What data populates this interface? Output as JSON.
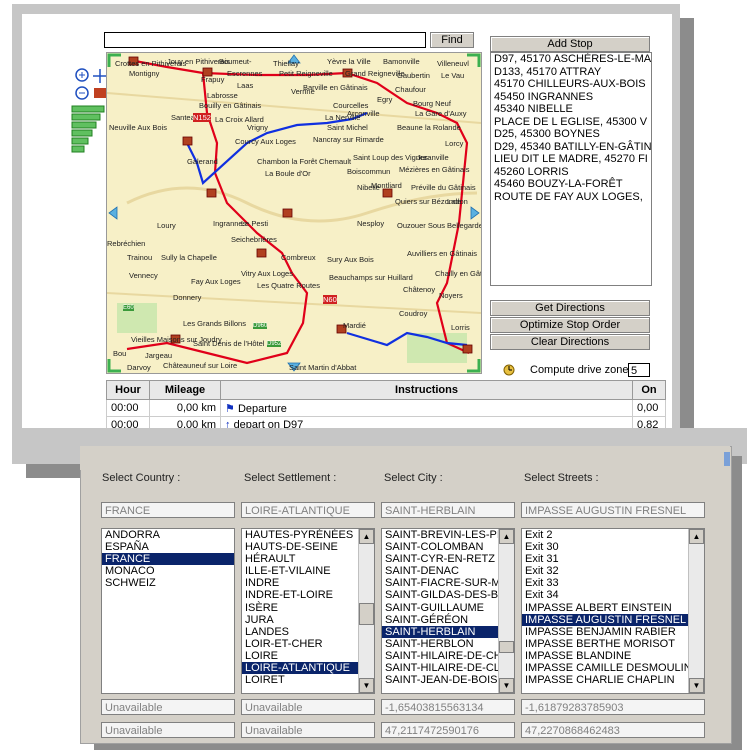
{
  "route_panel": {
    "find_button": "Find",
    "add_stop_button": "Add Stop",
    "stops": [
      "D97, 45170 ASCHÈRES-LE-MA",
      "D133, 45170 ATTRAY",
      "45170 CHILLEURS-AUX-BOIS",
      "45450 INGRANNES",
      "45340 NIBELLE",
      "PLACE DE L EGLISE, 45300 V",
      "D25, 45300 BOYNES",
      "D29, 45340 BATILLY-EN-GÂTIN",
      "LIEU DIT LE MADRE, 45270 FI",
      "45260 LORRIS",
      "45460 BOUZY-LA-FORÊT",
      "ROUTE DE FAY AUX LOGES,"
    ],
    "get_directions": "Get Directions",
    "optimize_stop_order": "Optimize Stop Order",
    "clear_directions": "Clear Directions",
    "compute_drive_zone": "Compute drive zone:",
    "drive_zone_value": "5",
    "map_labels": [
      "Crottes en Pithiverais",
      "Jouy en Pithiverais",
      "Boumeut-",
      "Thiellay",
      "Yèvre la Ville",
      "Bamonville",
      "Villeneuvl",
      "Montigny",
      "Escrennes",
      "Petit Reigneville",
      "Grand Reigneville",
      "Gaubertin",
      "Le Vau",
      "Frapuy",
      "Laas",
      "Barville en Gâtinais",
      "Chaufour",
      "Verrine",
      "Egry",
      "Labrosse",
      "Bouilly en Gâtinais",
      "Courcelles",
      "Bourg Neuf",
      "Arconville",
      "Santeau",
      "La Croix Allard",
      "La Nerville",
      "La Gare d'Auxy",
      "Neuville Aux Bois",
      "Vrigny",
      "Saint Michel",
      "Beaune la Rolande",
      "N152",
      "Courcy Aux Loges",
      "Nancray sur Rimarde",
      "Lorcy",
      "Galerand",
      "Chambon la Forêt",
      "Chemault",
      "Saint Loup des Vignes",
      "Juranville",
      "Mézières en Gâtinais",
      "La Boule d'Or",
      "Boiscommun",
      "Nibelle",
      "Montliard",
      "Préville du Gâtinais",
      "Quiers sur Bézonde",
      "Ladon",
      "Loury",
      "Ingrannes",
      "Le Pesti",
      "Rebréchien",
      "Nesploy",
      "Ouzouer Sous Bellegarde",
      "Seichebrières",
      "Trainou",
      "Sully la Chapelle",
      "Sury Aux Bois",
      "Combreux",
      "Auvilliers en Gâtinais",
      "Vennecy",
      "Vitry Aux Loges",
      "Beauchamps sur Huillard",
      "Chailly en Gâtinais",
      "Fay Aux Loges",
      "Les Quatre Routes",
      "Châtenoy",
      "Donnery",
      "Noyers",
      "N60",
      "Coudroy",
      "Les Grands Billons",
      "Mardié",
      "Vieilles Maisons sur Joudry",
      "Lorris",
      "Bou",
      "Jargeau",
      "Saint Denis de l'Hôtel",
      "D952",
      "Darvoy",
      "Châteauneuf sur Loire",
      "Saint Martin d'Abbat",
      "D960",
      "E60"
    ],
    "table_headers": [
      "Hour",
      "Mileage",
      "Instructions",
      "On"
    ],
    "table_rows": [
      {
        "hour": "00:00",
        "mileage": "0,00 km",
        "instruction": "Departure",
        "on": "0,00"
      },
      {
        "hour": "00:00",
        "mileage": "0,00 km",
        "instruction": "depart on D97",
        "on": "0,82"
      }
    ]
  },
  "address_panel": {
    "headers": [
      "Select Country :",
      "Select Settlement :",
      "Select City :",
      "Select Streets :"
    ],
    "selected": [
      "FRANCE",
      "LOIRE-ATLANTIQUE",
      "SAINT-HERBLAIN",
      "IMPASSE AUGUSTIN FRESNEL"
    ],
    "countries": [
      "ANDORRA",
      "ESPAÑA",
      "FRANCE",
      "MONACO",
      "SCHWEIZ"
    ],
    "country_selected_index": 2,
    "settlements": [
      "HAUTES-PYRÉNÉES",
      "HAUTS-DE-SEINE",
      "HÉRAULT",
      "ILLE-ET-VILAINE",
      "INDRE",
      "INDRE-ET-LOIRE",
      "ISÈRE",
      "JURA",
      "LANDES",
      "LOIR-ET-CHER",
      "LOIRE",
      "LOIRE-ATLANTIQUE",
      "LOIRET"
    ],
    "settlement_selected_index": 11,
    "cities": [
      "SAINT-BREVIN-LES-PIN",
      "SAINT-COLOMBAN",
      "SAINT-CYR-EN-RETZ",
      "SAINT-DENAC",
      "SAINT-FIACRE-SUR-MA",
      "SAINT-GILDAS-DES-BO",
      "SAINT-GUILLAUME",
      "SAINT-GÉRÉON",
      "SAINT-HERBLAIN",
      "SAINT-HERBLON",
      "SAINT-HILAIRE-DE-CH",
      "SAINT-HILAIRE-DE-CLI",
      "SAINT-JEAN-DE-BOISE"
    ],
    "city_selected_index": 8,
    "streets": [
      "Exit 2",
      "Exit 30",
      "Exit 31",
      "Exit 32",
      "Exit 33",
      "Exit 34",
      "IMPASSE ALBERT EINSTEIN",
      "IMPASSE AUGUSTIN FRESNEL",
      "IMPASSE BENJAMIN RABIER",
      "IMPASSE BERTHE MORISOT",
      "IMPASSE BLANDINE",
      "IMPASSE CAMILLE DESMOULIN",
      "IMPASSE CHARLIE CHAPLIN"
    ],
    "street_selected_index": 7,
    "row1": [
      "Unavailable",
      "Unavailable",
      "-1,65403815563134",
      "-1,61879283785903"
    ],
    "row2": [
      "Unavailable",
      "Unavailable",
      "47,2117472590176",
      "47,2270868462483"
    ]
  },
  "colors": {
    "selection": "#0a246a",
    "route_red": "#e0001a",
    "route_blue": "#1030e0",
    "map_bg": "#f7f0c7"
  }
}
